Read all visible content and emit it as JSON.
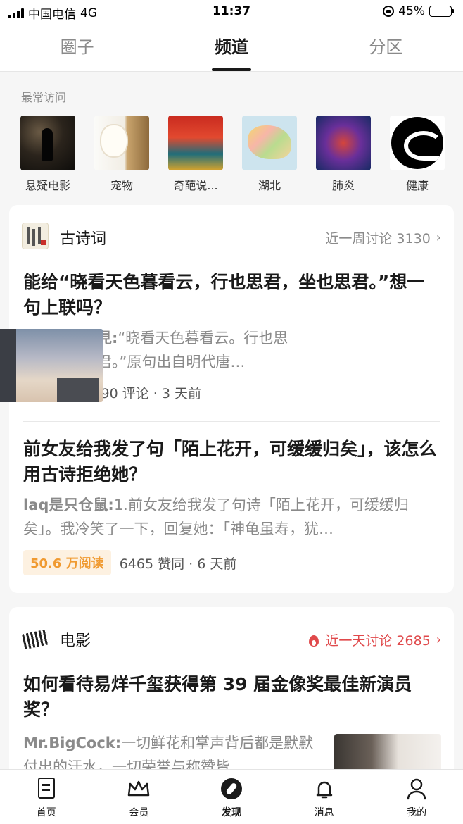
{
  "status_bar": {
    "carrier": "中国电信",
    "network": "4G",
    "time": "11:37",
    "battery": "45%",
    "battery_level": 0.45
  },
  "top_tabs": [
    {
      "label": "圈子",
      "active": false
    },
    {
      "label": "频道",
      "active": true
    },
    {
      "label": "分区",
      "active": false
    }
  ],
  "frequent": {
    "title": "最常访问",
    "items": [
      {
        "label": "悬疑电影"
      },
      {
        "label": "宠物"
      },
      {
        "label": "奇葩说..."
      },
      {
        "label": "湖北"
      },
      {
        "label": "肺炎"
      },
      {
        "label": "健康"
      }
    ]
  },
  "cards": [
    {
      "topic": "古诗词",
      "stat": "近一周讨论 3130",
      "posts": [
        {
          "title": "能给“晓看天色暮看云，行也思君，坐也思君。”想一句上联吗？",
          "author": "記得小蘋初見:",
          "excerpt": "“晓看天色暮看云。行也思君，坐也思君。”原句出自明代唐…",
          "meta": "1585 赞同 · 90 评论 · 3 天前"
        },
        {
          "title": "前女友给我发了句「陌上花开，可缓缓归矣」，该怎么用古诗拒绝她？",
          "author": "laq是只仓鼠:",
          "excerpt": "1.前女友给我发了句诗「陌上花开，可缓缓归矣」。我冷笑了一下，回复她：「神龟虽寿，犹…",
          "reads": "50.6 万阅读",
          "meta": "6465 赞同 · 6 天前"
        }
      ]
    },
    {
      "topic": "电影",
      "stat": "近一天讨论 2685",
      "posts": [
        {
          "title": "如何看待易烊千玺获得第 39 届金像奖最佳新演员奖？",
          "author": "Mr.BigCock:",
          "excerpt": "一切鲜花和掌声背后都是默默付出的汗水，一切荣誉与称赞皆"
        }
      ]
    }
  ],
  "bottom_nav": [
    {
      "label": "首页",
      "icon": "home-icon"
    },
    {
      "label": "会员",
      "icon": "crown-icon"
    },
    {
      "label": "发现",
      "icon": "compass-icon",
      "active": true
    },
    {
      "label": "消息",
      "icon": "bell-icon"
    },
    {
      "label": "我的",
      "icon": "user-icon"
    }
  ],
  "colors": {
    "hot": "#e0494b",
    "reads_badge": "#f09a31",
    "battery": "#f7c600"
  }
}
